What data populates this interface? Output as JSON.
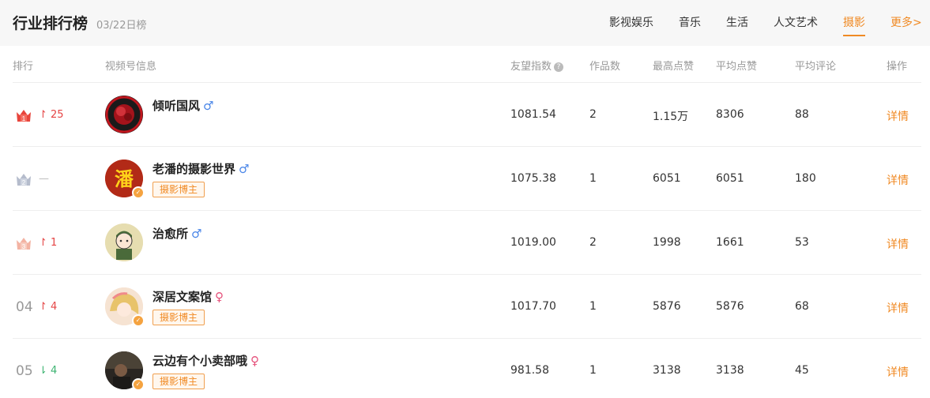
{
  "header": {
    "title": "行业排行榜",
    "date": "03/22日榜",
    "tabs": [
      {
        "label": "影视娱乐",
        "active": false
      },
      {
        "label": "音乐",
        "active": false
      },
      {
        "label": "生活",
        "active": false
      },
      {
        "label": "人文艺术",
        "active": false
      },
      {
        "label": "摄影",
        "active": true
      }
    ],
    "more_label": "更多>"
  },
  "columns": {
    "rank": "排行",
    "info": "视频号信息",
    "index": "友望指数",
    "index_help": "?",
    "works": "作品数",
    "max_likes": "最高点赞",
    "avg_likes": "平均点赞",
    "avg_comments": "平均评论",
    "action": "操作"
  },
  "colors": {
    "accent": "#f08a24",
    "gold": "#e8453c",
    "silver": "#b5bccc",
    "bronze": "#f3b3a3",
    "up": "#e54545",
    "down": "#3cb371"
  },
  "rows": [
    {
      "rank": "1",
      "rank_style": "crown-gold",
      "trend_dir": "up",
      "trend": "25",
      "name": "倾听国风",
      "gender": "♂",
      "tag": "",
      "index": "1081.54",
      "works": "2",
      "max_likes": "1.15万",
      "avg_likes": "8306",
      "avg_comments": "88",
      "action": "详情"
    },
    {
      "rank": "2",
      "rank_style": "crown-silver",
      "trend_dir": "flat",
      "trend": "—",
      "name": "老潘的摄影世界",
      "gender": "♂",
      "tag": "摄影博主",
      "avatar_text": "潘",
      "index": "1075.38",
      "works": "1",
      "max_likes": "6051",
      "avg_likes": "6051",
      "avg_comments": "180",
      "action": "详情"
    },
    {
      "rank": "3",
      "rank_style": "crown-bronze",
      "trend_dir": "up",
      "trend": "1",
      "name": "治愈所",
      "gender": "♂",
      "tag": "",
      "index": "1019.00",
      "works": "2",
      "max_likes": "1998",
      "avg_likes": "1661",
      "avg_comments": "53",
      "action": "详情"
    },
    {
      "rank": "04",
      "rank_style": "number",
      "trend_dir": "up",
      "trend": "4",
      "name": "深居文案馆",
      "gender": "♀",
      "tag": "摄影博主",
      "index": "1017.70",
      "works": "1",
      "max_likes": "5876",
      "avg_likes": "5876",
      "avg_comments": "68",
      "action": "详情"
    },
    {
      "rank": "05",
      "rank_style": "number",
      "trend_dir": "down",
      "trend": "4",
      "name": "云边有个小卖部哦",
      "gender": "♀",
      "tag": "摄影博主",
      "index": "981.58",
      "works": "1",
      "max_likes": "3138",
      "avg_likes": "3138",
      "avg_comments": "45",
      "action": "详情"
    }
  ]
}
